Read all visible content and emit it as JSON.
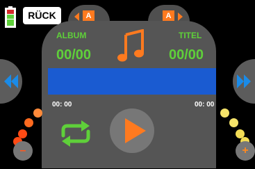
{
  "header": {
    "back_label": "RÜCK",
    "left_tab_badge": "A",
    "right_tab_badge": "A"
  },
  "player": {
    "album_label": "ALBUM",
    "album_count": "00/00",
    "title_label": "TITEL",
    "title_count": "00/00",
    "time_elapsed": "00: 00",
    "time_total": "00: 00",
    "music_icon": "music-note-icon",
    "repeat_icon": "repeat-icon",
    "play_icon": "play-icon"
  },
  "controls": {
    "minus_label": "–",
    "plus_label": "+",
    "prev_icon": "rewind-icon",
    "next_icon": "fast-forward-icon"
  },
  "colors": {
    "accent_orange": "#ff7a1f",
    "label_green": "#5fd03a",
    "progress_blue": "#1a5bd1",
    "skip_blue": "#1a8be8",
    "dot_yellow": "#f5e36a",
    "dot_red": "#ff4a14"
  }
}
